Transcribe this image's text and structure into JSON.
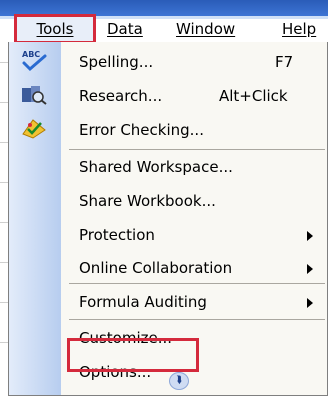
{
  "menubar": {
    "tools": "Tools",
    "data": "Data",
    "window": "Window",
    "help": "Help"
  },
  "menu": {
    "items": [
      {
        "label": "Spelling...",
        "shortcut": "F7",
        "icon": "spelling-icon"
      },
      {
        "label": "Research...",
        "shortcut": "Alt+Click",
        "icon": "research-icon"
      },
      {
        "label": "Error Checking...",
        "shortcut": "",
        "icon": "error-checking-icon"
      },
      {
        "label": "Shared Workspace...",
        "shortcut": ""
      },
      {
        "label": "Share Workbook...",
        "shortcut": ""
      },
      {
        "label": "Protection",
        "submenu": true
      },
      {
        "label": "Online Collaboration",
        "submenu": true
      },
      {
        "label": "Formula Auditing",
        "submenu": true
      },
      {
        "label": "Customize..."
      },
      {
        "label": "Options..."
      }
    ],
    "expand_icon": "chevron-double-down-icon"
  },
  "colors": {
    "highlight_border": "#d42a3c",
    "menu_bg": "#f9f8f3",
    "gutter": "#b7cdef"
  }
}
